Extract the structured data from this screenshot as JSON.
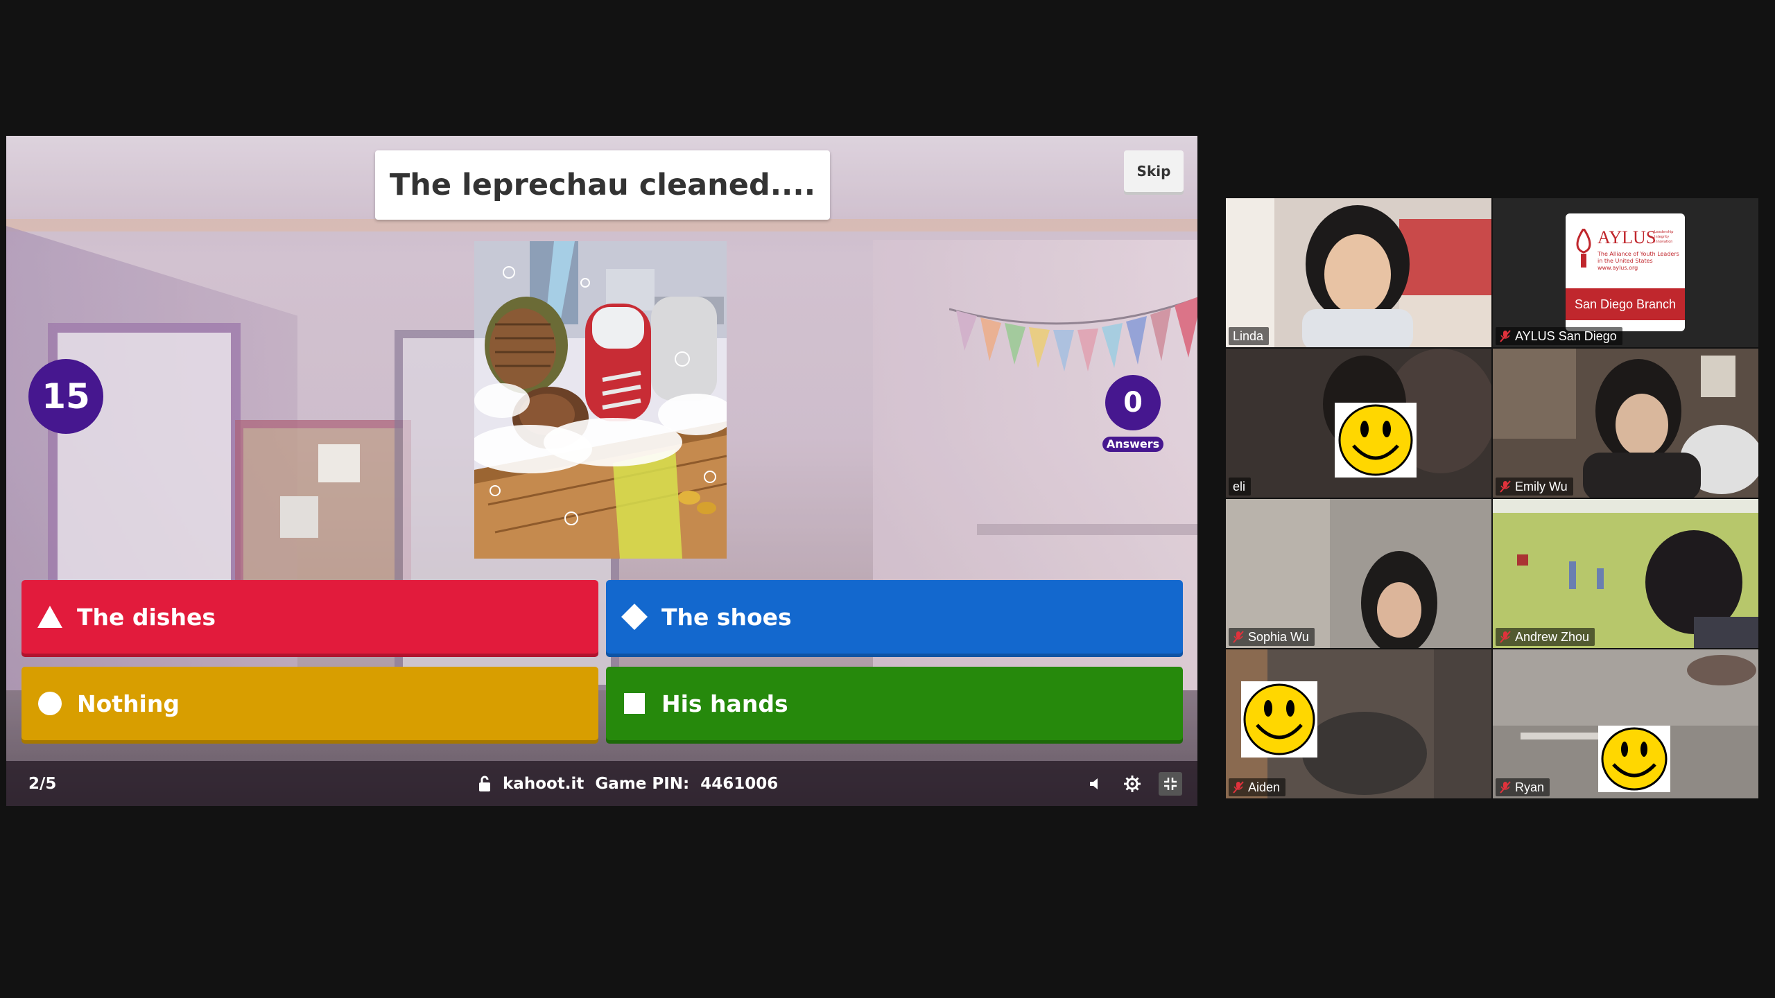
{
  "kahoot": {
    "question": "The leprechau cleaned....",
    "skip_label": "Skip",
    "timer": "15",
    "answers_count": "0",
    "answers_label": "Answers",
    "answers": [
      {
        "label": "The dishes",
        "color": "#e21b3c",
        "shape": "triangle-icon"
      },
      {
        "label": "The shoes",
        "color": "#1368ce",
        "shape": "diamond-icon"
      },
      {
        "label": "Nothing",
        "color": "#d89e00",
        "shape": "circle-icon"
      },
      {
        "label": "His hands",
        "color": "#26890c",
        "shape": "square-icon"
      }
    ],
    "progress": "2/5",
    "site": "kahoot.it",
    "pin_label": "Game PIN:",
    "pin": "4461006",
    "purple": "#46178f"
  },
  "participants": [
    {
      "name": "Linda",
      "muted": false,
      "active": true
    },
    {
      "name": "AYLUS San Diego",
      "muted": true,
      "active": false
    },
    {
      "name": "eli",
      "muted": false,
      "active": false
    },
    {
      "name": "Emily Wu",
      "muted": true,
      "active": false
    },
    {
      "name": "Sophia Wu",
      "muted": true,
      "active": false
    },
    {
      "name": "Andrew Zhou",
      "muted": true,
      "active": false
    },
    {
      "name": "Aiden",
      "muted": true,
      "active": false
    },
    {
      "name": "Ryan",
      "muted": true,
      "active": false
    }
  ],
  "aylus_logo": {
    "title": "AYLUS",
    "tagline_1": "Leadership",
    "tagline_2": "Integrity",
    "tagline_3": "Innovation",
    "subtitle_1": "The Alliance of Youth Leaders",
    "subtitle_2": "in the United States",
    "url": "www.aylus.org",
    "branch": "San Diego Branch"
  }
}
